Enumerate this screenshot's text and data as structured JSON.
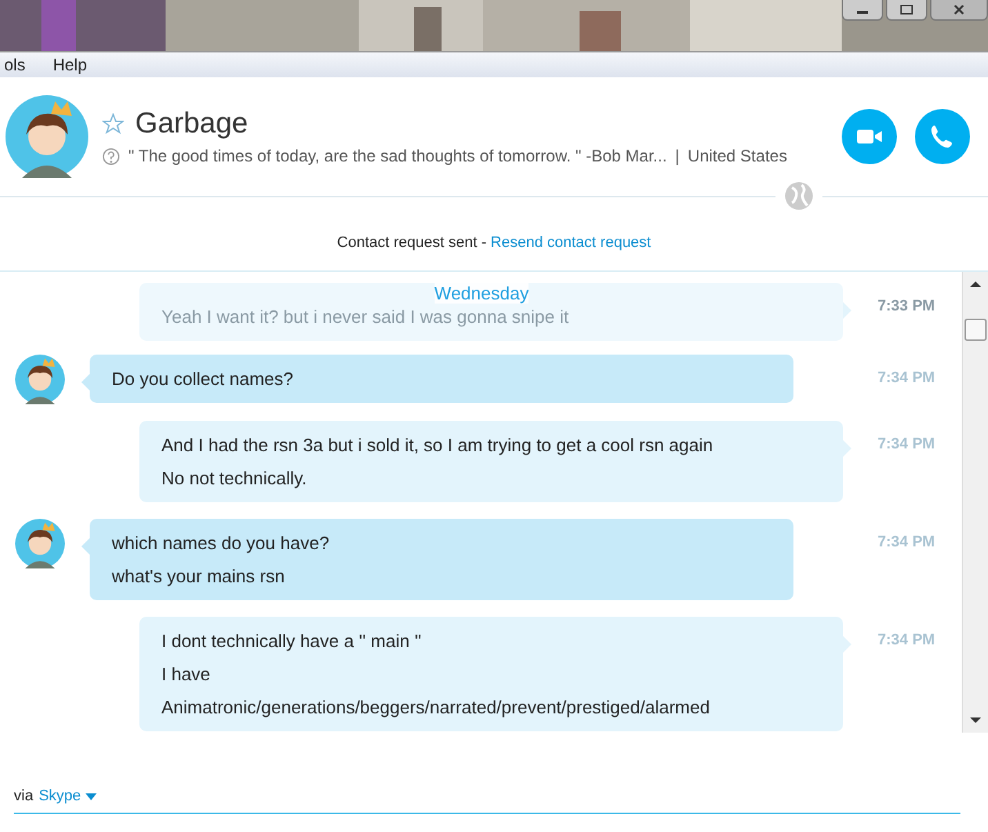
{
  "menu_bar": {
    "items": [
      "ols",
      "Help"
    ]
  },
  "contact": {
    "name": "Garbage",
    "favorite": false,
    "mood": "\" The good times of today, are the sad thoughts of tomorrow. \" -Bob Mar...",
    "separator": "|",
    "location": "United States"
  },
  "contact_request": {
    "status": "Contact request sent - ",
    "link": "Resend contact request"
  },
  "chat": {
    "date": "Wednesday",
    "messages": [
      {
        "kind": "outgoing",
        "faded": true,
        "lines": [
          "Yeah I want it? but i never said I was gonna snipe it"
        ],
        "time": "7:33 PM"
      },
      {
        "kind": "incoming",
        "faded": false,
        "lines": [
          "Do you collect names?"
        ],
        "time": "7:34 PM"
      },
      {
        "kind": "outgoing",
        "faded": false,
        "lines": [
          "And I had the rsn 3a but i sold it, so I am trying to get a cool rsn again",
          "No not technically."
        ],
        "time": "7:34 PM"
      },
      {
        "kind": "incoming",
        "faded": false,
        "lines": [
          "which names do you have?",
          "what's your mains rsn"
        ],
        "time": "7:34 PM"
      },
      {
        "kind": "outgoing",
        "faded": false,
        "lines": [
          "I dont technically have a '' main ''",
          "I have",
          "Animatronic/generations/beggers/narrated/prevent/prestiged/alarmed"
        ],
        "time": "7:34 PM"
      }
    ]
  },
  "footer": {
    "via": "via",
    "service": "Skype"
  }
}
